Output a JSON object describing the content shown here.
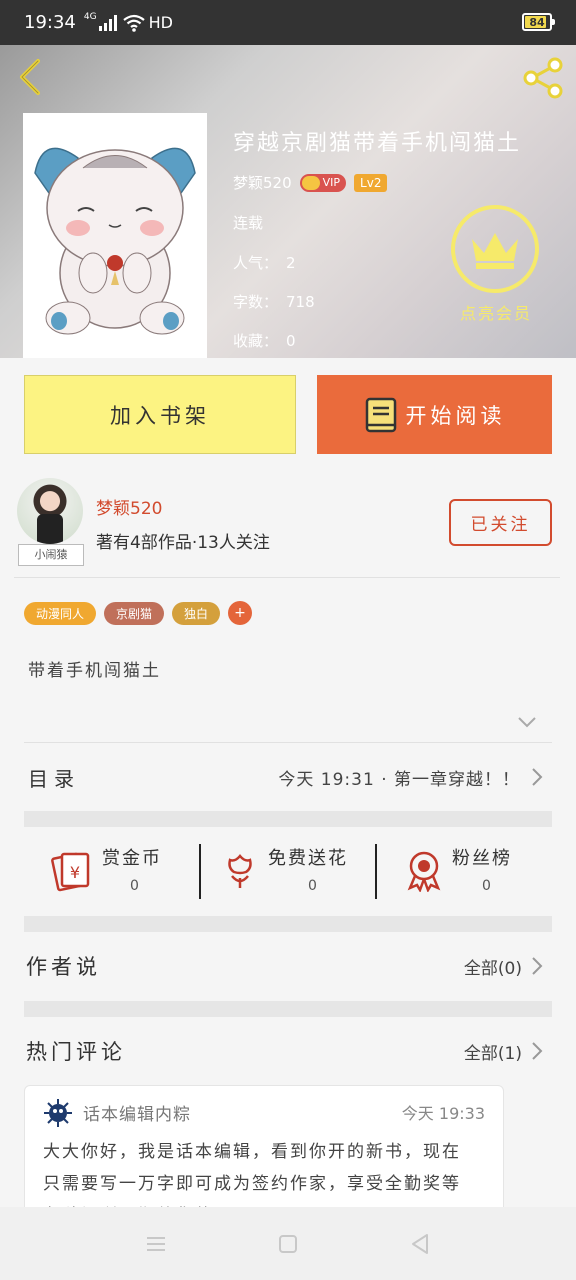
{
  "status_bar": {
    "time": "19:34",
    "network": "4G",
    "hd": "HD",
    "battery": "84"
  },
  "book": {
    "title": "穿越京剧猫带着手机闯猫土",
    "author": "梦颖520",
    "vip_label": "VIP",
    "level": "Lv2",
    "status": "连载",
    "popularity_label": "人气：",
    "popularity": "2",
    "word_count_label": "字数：",
    "word_count": "718",
    "favorites_label": "收藏：",
    "favorites": "0",
    "member_label": "点亮会员",
    "intro": "带着手机闯猫土"
  },
  "actions": {
    "add_shelf": "加入书架",
    "start_reading": "开始阅读"
  },
  "author_card": {
    "name": "梦颖520",
    "summary": "著有4部作品·13人关注",
    "avatar_tag": "小闹猿",
    "follow_label": "已关注"
  },
  "tags": [
    {
      "label": "动漫同人",
      "color": "#f0a830"
    },
    {
      "label": "京剧猫",
      "color": "#c0705a"
    },
    {
      "label": "独白",
      "color": "#d4a03c"
    }
  ],
  "tag_add": "+",
  "catalog": {
    "label": "目录",
    "latest": "今天 19:31 · 第一章穿越！！"
  },
  "stats": [
    {
      "title": "赏金币",
      "value": "0",
      "icon": "red-envelope-icon"
    },
    {
      "title": "免费送花",
      "value": "0",
      "icon": "flower-icon"
    },
    {
      "title": "粉丝榜",
      "value": "0",
      "icon": "medal-icon"
    }
  ],
  "author_says": {
    "title": "作者说",
    "all": "全部(0)"
  },
  "hot_comments": {
    "title": "热门评论",
    "all": "全部(1)"
  },
  "comment": {
    "user": "话本编辑内粽",
    "time": "今天 19:33",
    "text": "大大你好，我是话本编辑，看到你开的新书，现在只需要写一万字即可成为签约作家，享受全勤奖等各种福利，期待您的"
  },
  "colors": {
    "accent": "#ea6b3c",
    "shelf": "#fcf382",
    "author_red": "#d24b2e",
    "gold": "#f6ea6a"
  }
}
